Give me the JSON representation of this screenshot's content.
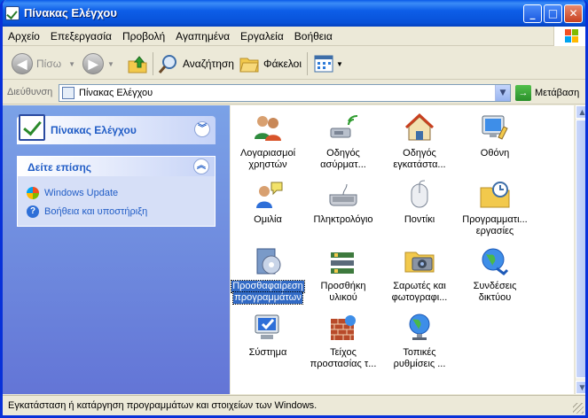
{
  "window": {
    "title": "Πίνακας Ελέγχου",
    "minimize": "_",
    "maximize": "□",
    "close": "✕"
  },
  "menu": [
    "Αρχείο",
    "Επεξεργασία",
    "Προβολή",
    "Αγαπημένα",
    "Εργαλεία",
    "Βοήθεια"
  ],
  "toolbar": {
    "back": "Πίσω",
    "search": "Αναζήτηση",
    "folders": "Φάκελοι"
  },
  "address": {
    "label": "Διεύθυνση",
    "value": "Πίνακας Ελέγχου",
    "go": "Μετάβαση"
  },
  "left_pane": {
    "title": "Πίνακας Ελέγχου",
    "see_also": {
      "title": "Δείτε επίσης",
      "links": [
        "Windows Update",
        "Βοήθεια και υποστήριξη"
      ]
    }
  },
  "items": [
    {
      "line1": "Λογαριασμοί",
      "line2": "χρηστών",
      "icon": "user-accounts-icon"
    },
    {
      "line1": "Οδηγός",
      "line2": "ασύρματ...",
      "icon": "wireless-wizard-icon"
    },
    {
      "line1": "Οδηγός",
      "line2": "εγκατάστα...",
      "icon": "network-setup-icon"
    },
    {
      "line1": "Οθόνη",
      "line2": "",
      "icon": "display-icon"
    },
    {
      "line1": "Ομιλία",
      "line2": "",
      "icon": "speech-icon"
    },
    {
      "line1": "Πληκτρολόγιο",
      "line2": "",
      "icon": "keyboard-icon"
    },
    {
      "line1": "Ποντίκι",
      "line2": "",
      "icon": "mouse-icon"
    },
    {
      "line1": "Προγραμματι...",
      "line2": "εργασίες",
      "icon": "scheduled-tasks-icon"
    },
    {
      "line1": "Προσθαφαίρεση",
      "line2": "προγραμμάτων",
      "icon": "add-remove-programs-icon"
    },
    {
      "line1": "Προσθήκη",
      "line2": "υλικού",
      "icon": "add-hardware-icon"
    },
    {
      "line1": "Σαρωτές και",
      "line2": "φωτογραφι...",
      "icon": "scanners-cameras-icon"
    },
    {
      "line1": "Συνδέσεις",
      "line2": "δικτύου",
      "icon": "network-connections-icon"
    },
    {
      "line1": "Σύστημα",
      "line2": "",
      "icon": "system-icon"
    },
    {
      "line1": "Τείχος",
      "line2": "προστασίας τ...",
      "icon": "firewall-icon"
    },
    {
      "line1": "Τοπικές",
      "line2": "ρυθμίσεις ...",
      "icon": "regional-settings-icon"
    }
  ],
  "selected_item": "Προσθαφαίρεση",
  "status": "Εγκατάσταση ή κατάργηση προγραμμάτων και στοιχείων των Windows."
}
